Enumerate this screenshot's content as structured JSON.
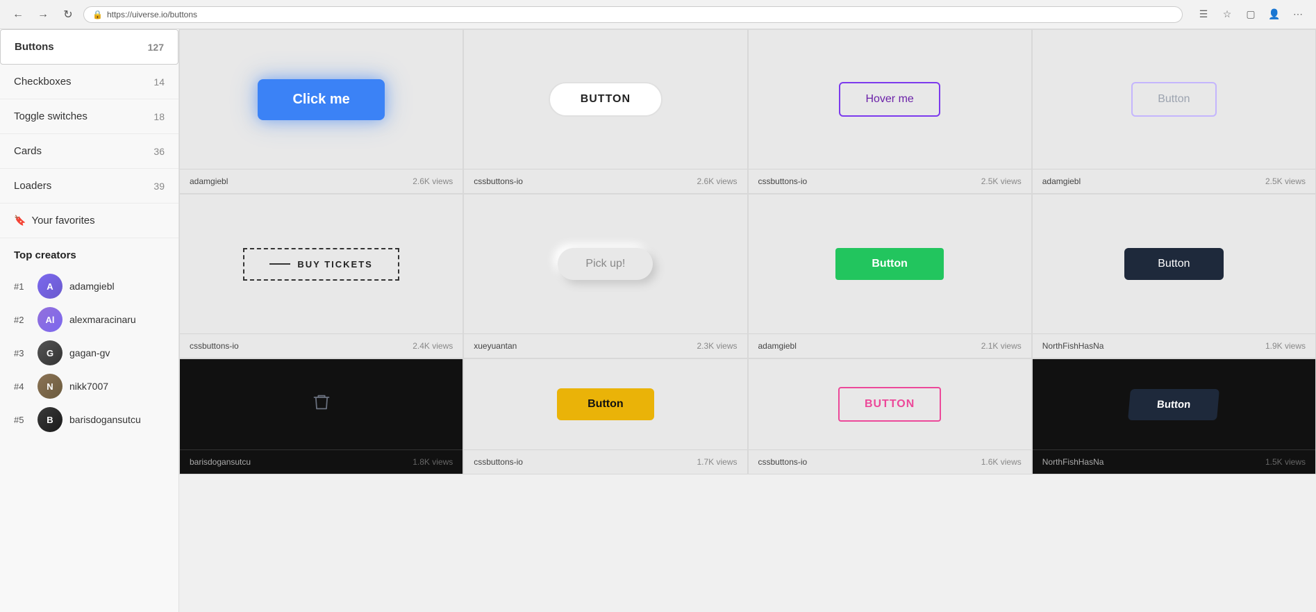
{
  "browser": {
    "url": "https://uiverse.io/buttons",
    "back_label": "←",
    "forward_label": "→",
    "reload_label": "↺"
  },
  "sidebar": {
    "items": [
      {
        "id": "buttons",
        "label": "Buttons",
        "count": "127",
        "active": true
      },
      {
        "id": "checkboxes",
        "label": "Checkboxes",
        "count": "14",
        "active": false
      },
      {
        "id": "toggle-switches",
        "label": "Toggle switches",
        "count": "18",
        "active": false
      },
      {
        "id": "cards",
        "label": "Cards",
        "count": "36",
        "active": false
      },
      {
        "id": "loaders",
        "label": "Loaders",
        "count": "39",
        "active": false
      }
    ],
    "favorites": {
      "label": "Your favorites"
    },
    "top_creators": {
      "title": "Top creators",
      "creators": [
        {
          "rank": "#1",
          "name": "adamgiebl",
          "initials": "A"
        },
        {
          "rank": "#2",
          "name": "alexmaracinaru",
          "initials": "Al"
        },
        {
          "rank": "#3",
          "name": "gagan-gv",
          "initials": "G"
        },
        {
          "rank": "#4",
          "name": "nikk7007",
          "initials": "N"
        },
        {
          "rank": "#5",
          "name": "barisdogansutcu",
          "initials": "B"
        }
      ]
    }
  },
  "cards": {
    "row1": [
      {
        "id": "card-1",
        "author": "adamgiebl",
        "views": "2.6K views",
        "button_label": "Click me",
        "dark": false
      },
      {
        "id": "card-2",
        "author": "cssbuttons-io",
        "views": "2.6K views",
        "button_label": "BUTTON",
        "dark": false
      },
      {
        "id": "card-3",
        "author": "cssbuttons-io",
        "views": "2.5K views",
        "button_label": "Hover me",
        "dark": false
      },
      {
        "id": "card-4",
        "author": "adamgiebl",
        "views": "2.5K views",
        "button_label": "Button",
        "dark": false
      }
    ],
    "row2": [
      {
        "id": "card-5",
        "author": "cssbuttons-io",
        "views": "2.4K views",
        "button_label": "BUY TICKETS",
        "dark": false
      },
      {
        "id": "card-6",
        "author": "xueyuantan",
        "views": "2.3K views",
        "button_label": "Pick up!",
        "dark": false
      },
      {
        "id": "card-7",
        "author": "adamgiebl",
        "views": "2.1K views",
        "button_label": "Button",
        "dark": false
      },
      {
        "id": "card-8",
        "author": "NorthFishHasNa",
        "views": "1.9K views",
        "button_label": "Button",
        "dark": false
      }
    ],
    "row3": [
      {
        "id": "card-9",
        "author": "barisdogansutcu",
        "views": "1.8K views",
        "button_label": "🗑",
        "dark": true
      },
      {
        "id": "card-10",
        "author": "cssbuttons-io",
        "views": "1.7K views",
        "button_label": "Button",
        "dark": false
      },
      {
        "id": "card-11",
        "author": "cssbuttons-io",
        "views": "1.6K views",
        "button_label": "BUTTON",
        "dark": false
      },
      {
        "id": "card-12",
        "author": "NorthFishHasNa",
        "views": "1.5K views",
        "button_label": "Button",
        "dark": true
      }
    ]
  }
}
